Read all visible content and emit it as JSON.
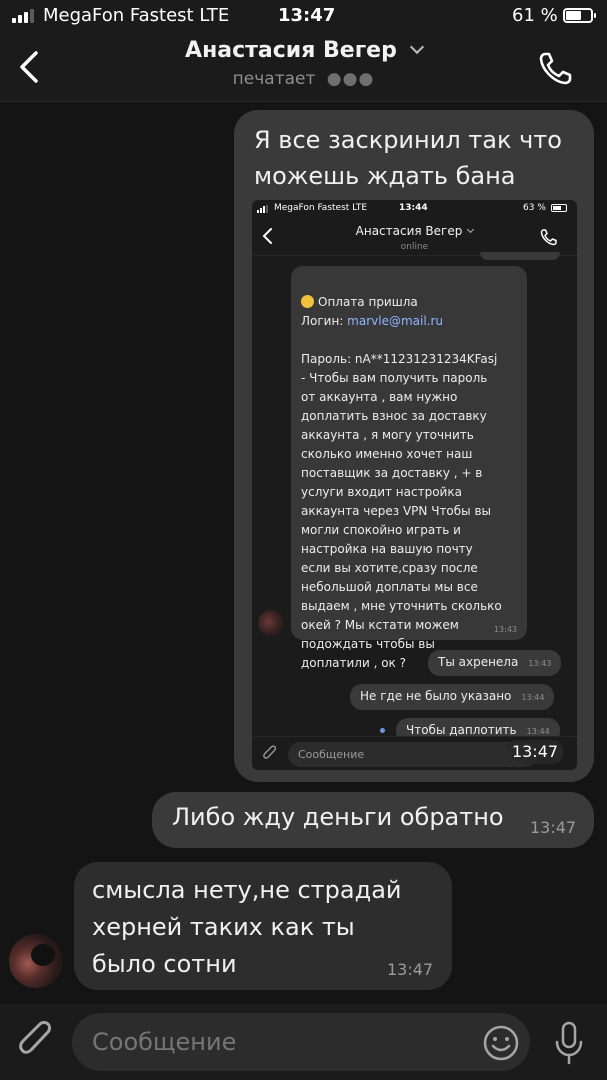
{
  "status_bar": {
    "carrier": "MegaFon Fastest LTE",
    "time": "13:47",
    "battery": "61 %",
    "battery_level": 0.61
  },
  "header": {
    "contact_name": "Анастасия Вегер",
    "status": "печатает",
    "typing_dots": "●●●"
  },
  "messages": {
    "outgoing_1": "Я все заскринил так что можешь ждать бана",
    "outgoing_2": {
      "text": "Либо жду деньги обратно",
      "time": "13:47"
    },
    "incoming_1": {
      "text": "смысла нету,не страдай херней таких как ты было сотни",
      "time": "13:47"
    }
  },
  "screenshot": {
    "time_badge": "13:47",
    "status_bar": {
      "carrier": "MegaFon Fastest LTE",
      "time": "13:44",
      "battery": "63 %",
      "battery_level": 0.63
    },
    "header": {
      "contact_name": "Анастасия Вегер",
      "status": "online"
    },
    "incoming": {
      "line1": "Оплата пришла",
      "login_label": "Логин: ",
      "login_value": "marvle@mail.ru",
      "body": "Пароль: nA**11231231234KFasj\n- Чтобы вам получить пароль\nот аккаунта , вам нужно\nдоплатить взнос за доставку\nаккаунта , я могу уточнить\nсколько именно хочет наш\nпоставщик за доставку , + в\nуслуги входит настройка\nаккаунта через VPN Чтобы вы\nмогли спокойно играть и\nнастройка на вашую почту\nесли вы хотите,сразу после\nнебольшой доплаты мы все\nвыдаем , мне уточнить сколько\nокей ? Мы кстати можем\nподождать чтобы вы\nдоплатили , ок ?",
      "time": "13:43"
    },
    "outgoing": [
      {
        "text": "Ты ахренела",
        "time": "13:43"
      },
      {
        "text": "Не где не было указано",
        "time": "13:44"
      },
      {
        "text": "Чтобы даплотить",
        "time": "13:44"
      }
    ],
    "input_placeholder": "Сообщение"
  },
  "input": {
    "placeholder": "Сообщение"
  },
  "icons": [
    "back-chevron-icon",
    "phone-icon",
    "paperclip-icon",
    "emoji-icon",
    "microphone-icon",
    "signal-icon",
    "battery-icon"
  ]
}
